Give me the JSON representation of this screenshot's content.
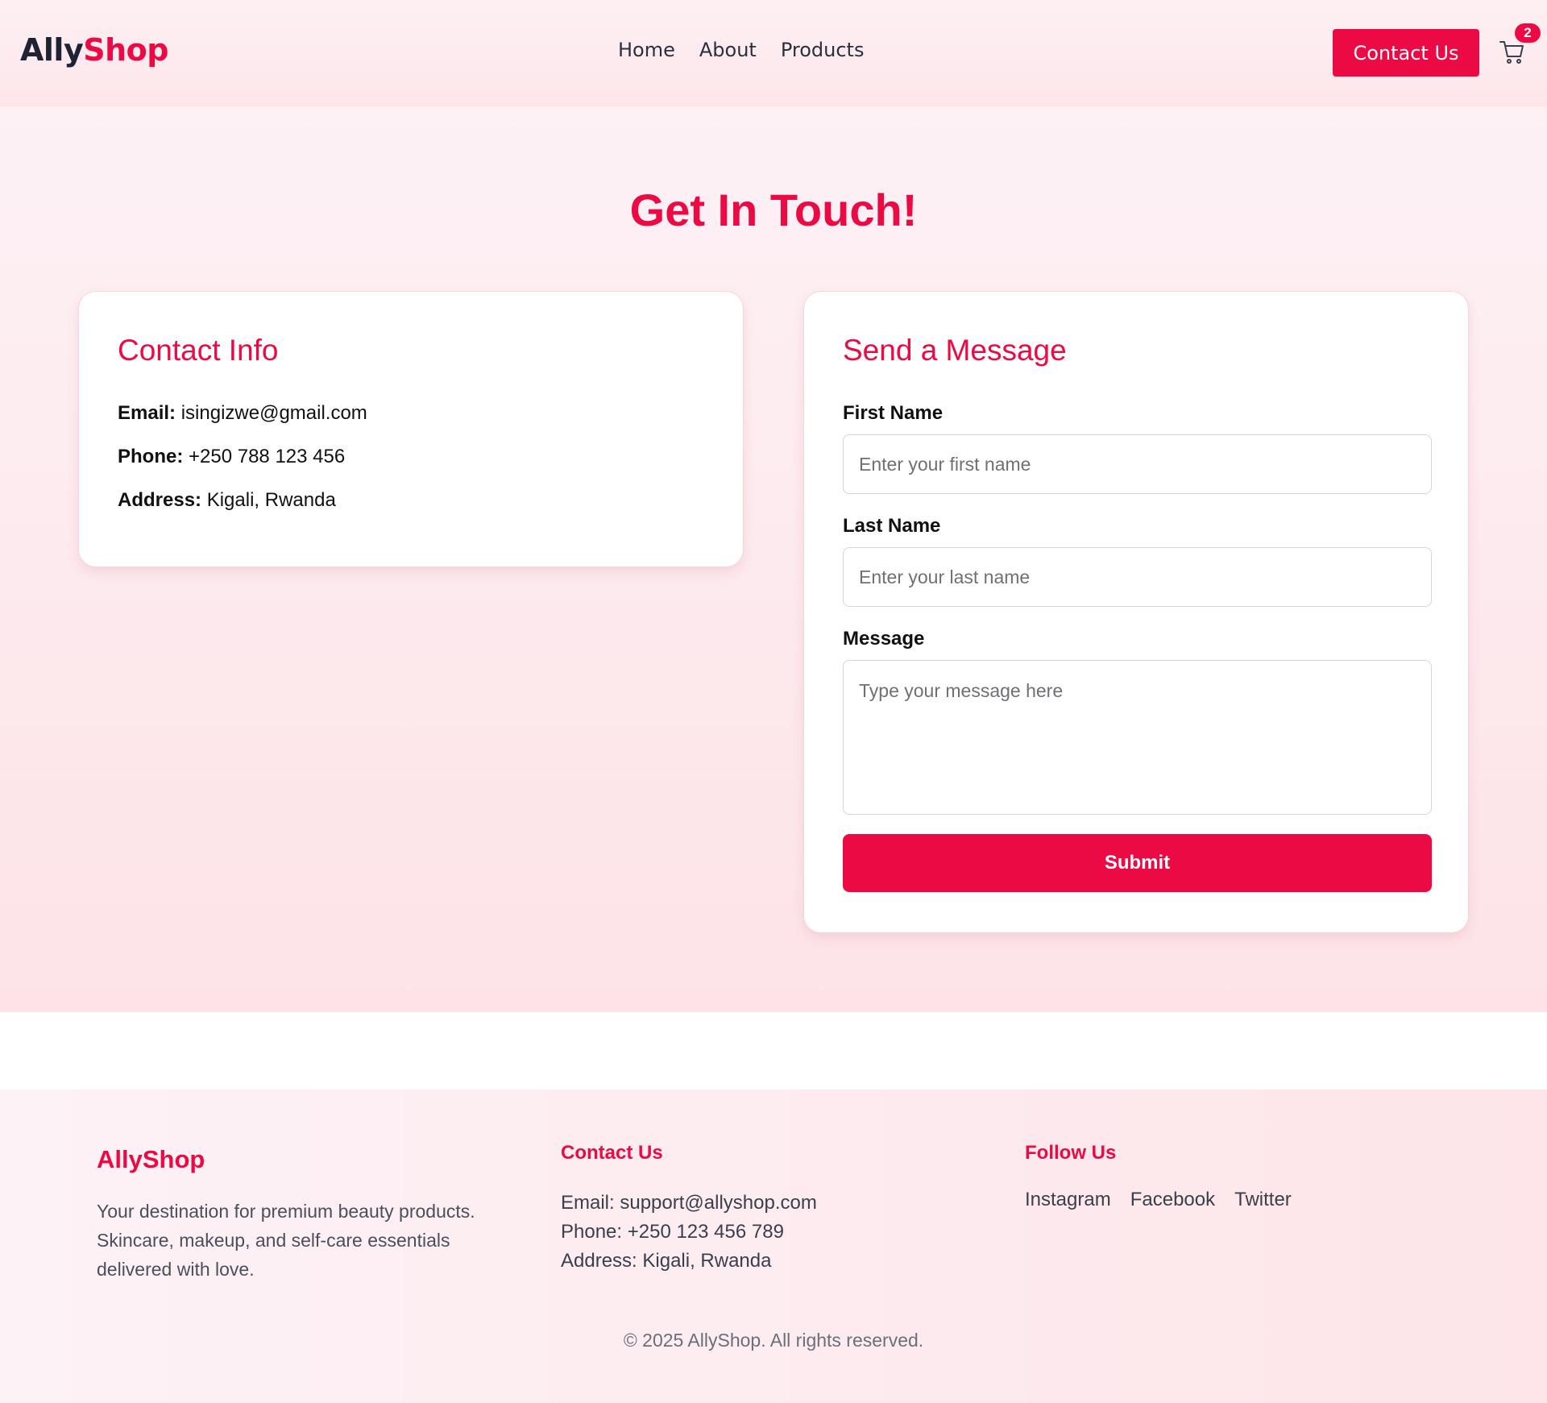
{
  "header": {
    "logo_part1": "Ally",
    "logo_part2": "Shop",
    "nav": [
      {
        "label": "Home"
      },
      {
        "label": "About"
      },
      {
        "label": "Products"
      }
    ],
    "contact_button": "Contact Us",
    "cart_count": "2",
    "cart_icon": "cart-icon"
  },
  "main": {
    "title": "Get In Touch!",
    "contact_info": {
      "heading": "Contact Info",
      "email_label": "Email:",
      "email_value": "isingizwe@gmail.com",
      "phone_label": "Phone:",
      "phone_value": "+250 788 123 456",
      "address_label": "Address:",
      "address_value": "Kigali, Rwanda"
    },
    "form": {
      "heading": "Send a Message",
      "first_name_label": "First Name",
      "first_name_placeholder": "Enter your first name",
      "last_name_label": "Last Name",
      "last_name_placeholder": "Enter your last name",
      "message_label": "Message",
      "message_placeholder": "Type your message here",
      "submit_label": "Submit"
    }
  },
  "footer": {
    "brand": "AllyShop",
    "description": "Your destination for premium beauty products. Skincare, makeup, and self-care essentials delivered with love.",
    "contact_heading": "Contact Us",
    "contact_lines": [
      "Email: support@allyshop.com",
      "Phone: +250 123 456 789",
      "Address: Kigali, Rwanda"
    ],
    "follow_heading": "Follow Us",
    "social": [
      {
        "label": "Instagram"
      },
      {
        "label": "Facebook"
      },
      {
        "label": "Twitter"
      }
    ],
    "copyright": "© 2025 AllyShop. All rights reserved."
  },
  "colors": {
    "accent": "#ec0a44",
    "dark": "#1e2233"
  }
}
